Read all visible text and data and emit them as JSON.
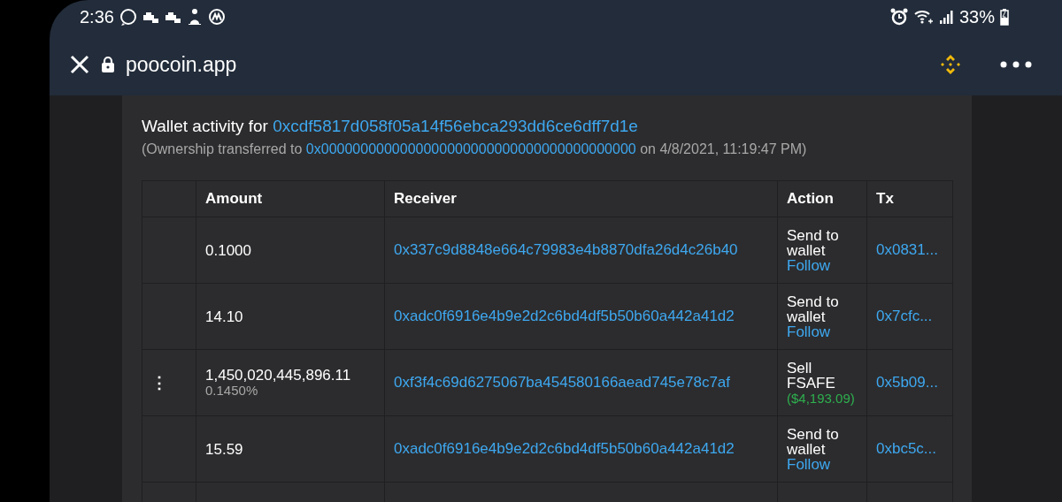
{
  "status_bar": {
    "time": "2:36",
    "battery": "33%"
  },
  "browser": {
    "url": "poocoin.app"
  },
  "wallet": {
    "prefix": "Wallet activity for",
    "address": "0xcdf5817d058f05a14f56ebca293dd6ce6dff7d1e",
    "note_prefix": "(Ownership transferred to",
    "note_address": "0x0000000000000000000000000000000000000000",
    "note_suffix": "on 4/8/2021, 11:19:47 PM)"
  },
  "table": {
    "columns": [
      "Amount",
      "Receiver",
      "Action",
      "Tx"
    ],
    "rows": [
      {
        "kind": "transfer",
        "amount": "0.1000",
        "receiver": "0x337c9d8848e664c79983e4b8870dfa26d4c26b40",
        "action": "Send to wallet",
        "action_link": "Follow",
        "tx": "0x0831..."
      },
      {
        "kind": "transfer",
        "amount": "14.10",
        "receiver": "0xadc0f6916e4b9e2d2c6bd4df5b50b60a442a41d2",
        "action": "Send to wallet",
        "action_link": "Follow",
        "tx": "0x7cfc..."
      },
      {
        "kind": "sell",
        "menu": "⋮",
        "amount": "1,450,020,445,896.11",
        "share": "0.1450%",
        "receiver": "0xf3f4c69d6275067ba454580166aead745e78c7af",
        "action": "Sell FSAFE",
        "value": "($4,193.09)",
        "tx": "0x5b09..."
      },
      {
        "kind": "transfer",
        "amount": "15.59",
        "receiver": "0xadc0f6916e4b9e2d2c6bd4df5b50b60a442a41d2",
        "action": "Send to wallet",
        "action_link": "Follow",
        "tx": "0xbc5c..."
      }
    ]
  }
}
